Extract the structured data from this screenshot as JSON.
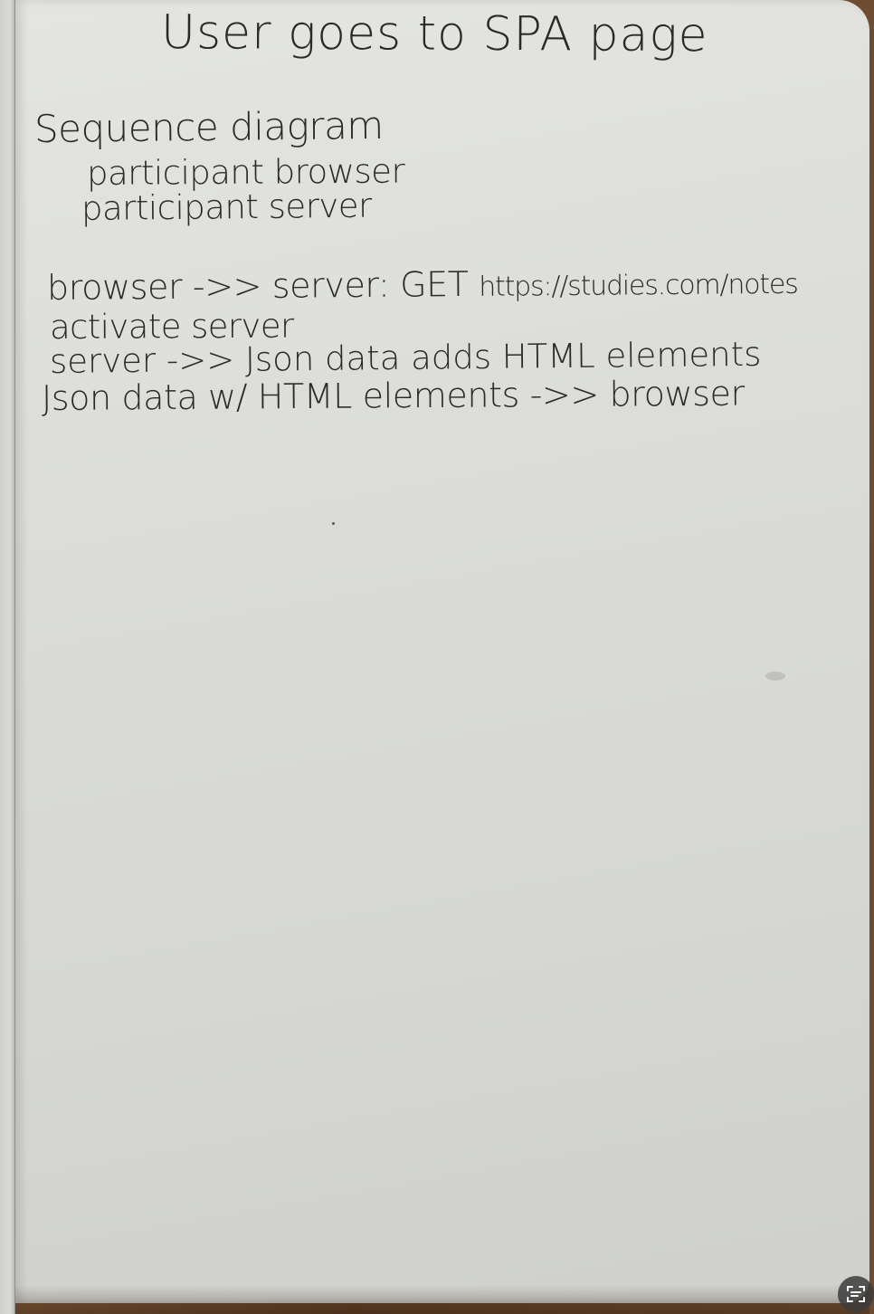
{
  "note": {
    "title": "User goes to SPA page",
    "heading": "Sequence diagram",
    "participants": [
      "participant browser",
      "participant server"
    ],
    "lines": {
      "line1_prefix": "browser ->> server: GET ",
      "line1_url": "https://studies.com/notes",
      "line2": "activate server",
      "line3": "server ->> Json data adds HTML elements",
      "line4": "Json data w/ HTML elements ->> browser"
    }
  },
  "icons": {
    "live_text": "live-text-scan-icon"
  },
  "colors": {
    "ink": "#2a2a2c",
    "paper": "#dcddd9",
    "table": "#6b4a2f"
  }
}
